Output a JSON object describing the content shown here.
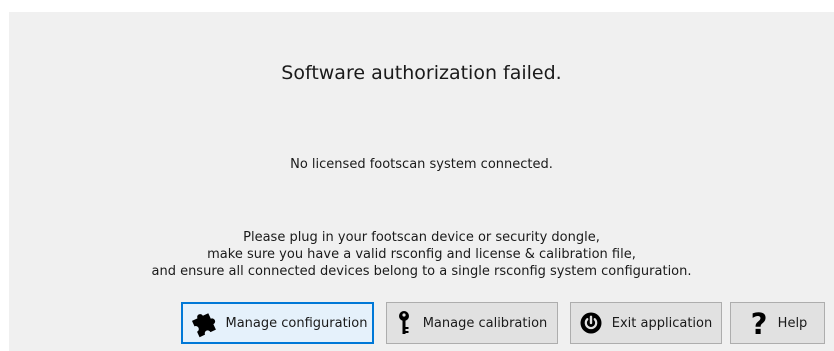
{
  "dialog": {
    "title": "Software authorization failed.",
    "subtitle": "No licensed footscan system connected.",
    "instructions": [
      "Please plug in your footscan device or security dongle,",
      "make sure you have a valid rsconfig and license & calibration file,",
      "and ensure all connected devices belong to a single rsconfig system configuration."
    ]
  },
  "buttons": {
    "manage_configuration": {
      "label": "Manage configuration",
      "icon": "puzzle-icon"
    },
    "manage_calibration": {
      "label": "Manage calibration",
      "icon": "key-icon"
    },
    "exit_application": {
      "label": "Exit application",
      "icon": "power-icon"
    },
    "help": {
      "label": "Help",
      "icon": "question-icon"
    }
  },
  "colors": {
    "dialog_background": "#f0f0f0",
    "focus_border": "#0078d7"
  }
}
